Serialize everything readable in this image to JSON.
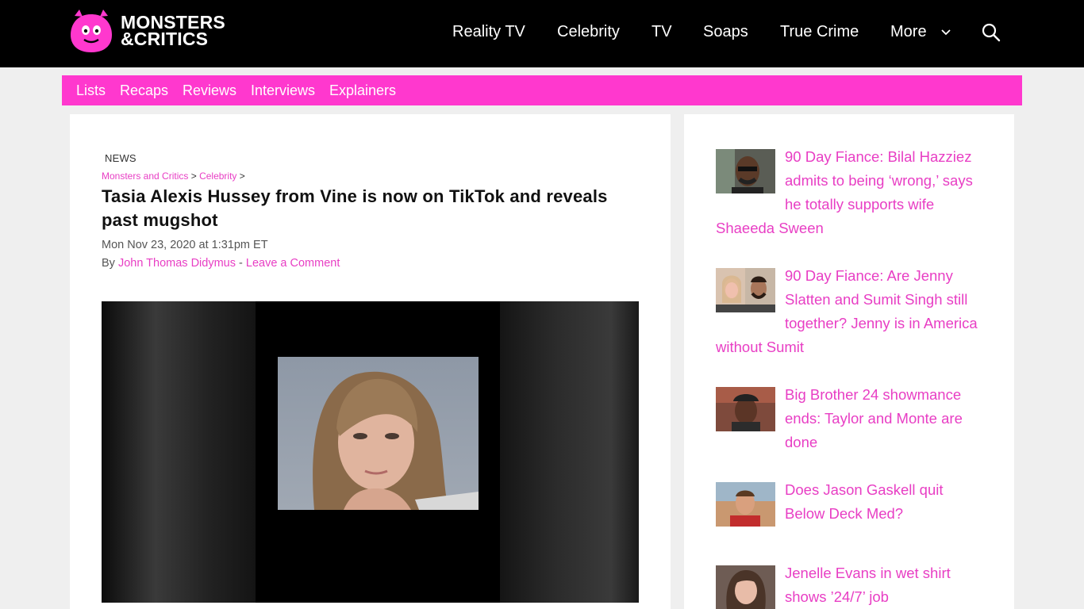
{
  "site": {
    "logo_line1": "MONSTERS",
    "logo_line2": "&CRITICS",
    "brand_pink": "#ff38ce",
    "link_pink": "#e83ec4"
  },
  "nav": {
    "items": [
      "Reality TV",
      "Celebrity",
      "TV",
      "Soaps",
      "True Crime",
      "More"
    ],
    "search_icon": "search-icon"
  },
  "subnav": {
    "items": [
      "Lists",
      "Recaps",
      "Reviews",
      "Interviews",
      "Explainers"
    ]
  },
  "article": {
    "category": "NEWS",
    "breadcrumb": [
      "Monsters and Critics",
      "Celebrity"
    ],
    "breadcrumb_sep": ">",
    "title": "Tasia Alexis Hussey from Vine is now on TikTok and reveals past mugshot",
    "date": "Mon Nov 23, 2020 at 1:31pm ET",
    "by_prefix": "By",
    "author": "John Thomas Didymus",
    "separator": "-",
    "comment_link": "Leave a Comment"
  },
  "sidebar": {
    "stories": [
      {
        "title": "90 Day Fiance: Bilal Hazziez admits to being ‘wrong,’ says he totally supports wife Shaeeda Sween"
      },
      {
        "title": "90 Day Fiance: Are Jenny Slatten and Sumit Singh still together? Jenny is in America without Sumit"
      },
      {
        "title": "Big Brother 24 showmance ends: Taylor and Monte are done"
      },
      {
        "title": "Does Jason Gaskell quit Below Deck Med?"
      },
      {
        "title": "Jenelle Evans in wet shirt shows ’24/7’ job"
      }
    ]
  }
}
